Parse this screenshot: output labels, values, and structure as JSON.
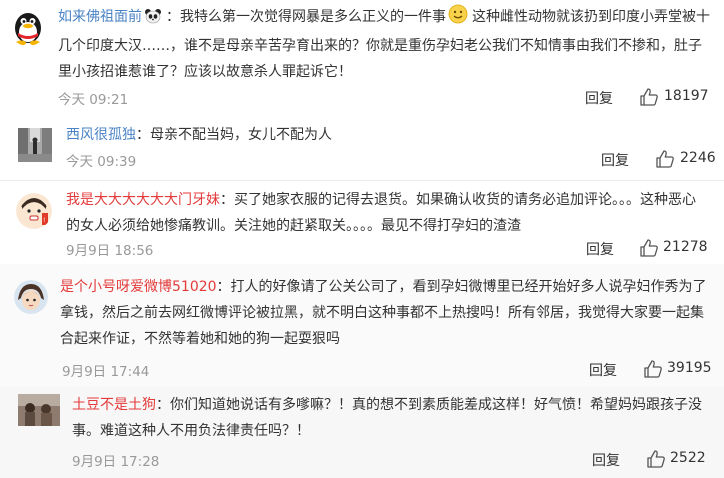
{
  "comments": [
    {
      "username": "如来佛祖面前",
      "separator": "：",
      "text_part1": "我特么第一次觉得网暴是多么正义的一件事",
      "text_part2": "这种雌性动物就该扔到印度小弄堂被十几个印度大汉……，谁不是母亲辛苦孕育出来的？你就是重伤孕妇老公我们不知情事由我们不掺和，肚子里小孩招谁惹谁了？应该以故意杀人罪起诉它！",
      "emoji": "smiley-icon",
      "badge": "panda-icon",
      "time": "今天 09:21",
      "reply": "回复",
      "likes": "18197"
    },
    {
      "username": "西风很孤独",
      "separator": "：",
      "text": "母亲不配当妈，女儿不配为人",
      "time": "今天 09:39",
      "reply": "回复",
      "likes": "2246"
    },
    {
      "username": "我是大大大大大大门牙妹",
      "separator": "：",
      "text": "买了她家衣服的记得去退货。如果确认收货的请务必追加评论。。。这种恶心的女人必须给她惨痛教训。关注她的赶紧取关。。。。最见不得打孕妇的渣渣",
      "time": "9月9日 18:56",
      "reply": "回复",
      "likes": "21278"
    },
    {
      "username": "是个小号呀爱微博51020",
      "separator": "：",
      "text": "打人的好像请了公关公司了，看到孕妇微博里已经开始好多人说孕妇作秀为了拿钱，然后之前去网红微博评论被拉黑，就不明白这种事都不上热搜吗！所有邻居，我觉得大家要一起集合起来作证，不然等着她和她的狗一起耍狠吗",
      "time": "9月9日 17:44",
      "reply": "回复",
      "likes": "39195"
    },
    {
      "username": "土豆不是土狗",
      "separator": "：",
      "text": "你们知道她说话有多嗲嘛？！真的想不到素质能差成这样！好气愤！希望妈妈跟孩子没事。难道这种人不用负法律责任吗？！",
      "time": "9月9日 17:28",
      "reply": "回复",
      "likes": "2522"
    }
  ],
  "colors": {
    "username_blue": "#4a83c5",
    "username_red": "#e43a3a",
    "meta_gray": "#999999",
    "text": "#333333"
  },
  "icons": {
    "like": "thumbs-up-icon"
  }
}
